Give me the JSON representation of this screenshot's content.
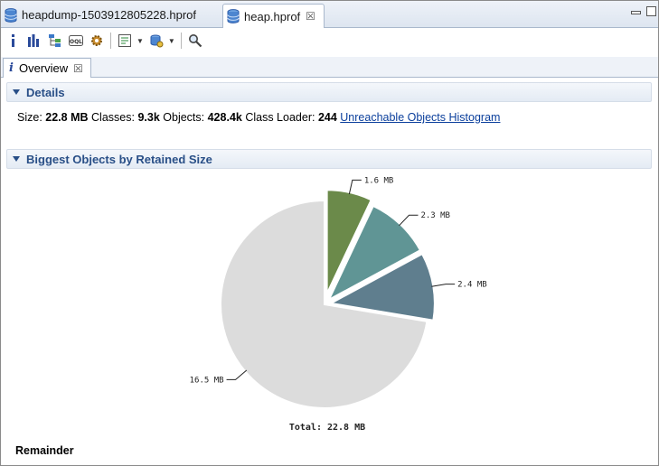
{
  "tabs": [
    {
      "label": "heapdump-1503912805228.hprof",
      "active": false
    },
    {
      "label": "heap.hprof",
      "active": true,
      "close": "☒"
    }
  ],
  "view_tab": {
    "label": "Overview",
    "close": "☒"
  },
  "sections": {
    "details": "Details",
    "biggest": "Biggest Objects by Retained Size"
  },
  "details": {
    "size_label": "Size:",
    "size_value": "22.8 MB",
    "classes_label": "Classes:",
    "classes_value": "9.3k",
    "objects_label": "Objects:",
    "objects_value": "428.4k",
    "loader_label": "Class Loader:",
    "loader_value": "244",
    "histogram_link": "Unreachable Objects Histogram"
  },
  "chart_data": {
    "type": "pie",
    "total_label": "Total: 22.8 MB",
    "slices": [
      {
        "label": "1.6 MB",
        "value": 1.6,
        "color": "#6b8a4a"
      },
      {
        "label": "2.3 MB",
        "value": 2.3,
        "color": "#609595"
      },
      {
        "label": "2.4 MB",
        "value": 2.4,
        "color": "#5f7e8e"
      },
      {
        "label": "16.5 MB",
        "value": 16.5,
        "color": "#dcdcdc"
      }
    ]
  },
  "selected_slice": "Remainder",
  "colors": {
    "header_text": "#294f87",
    "link": "#0b3f9c"
  }
}
